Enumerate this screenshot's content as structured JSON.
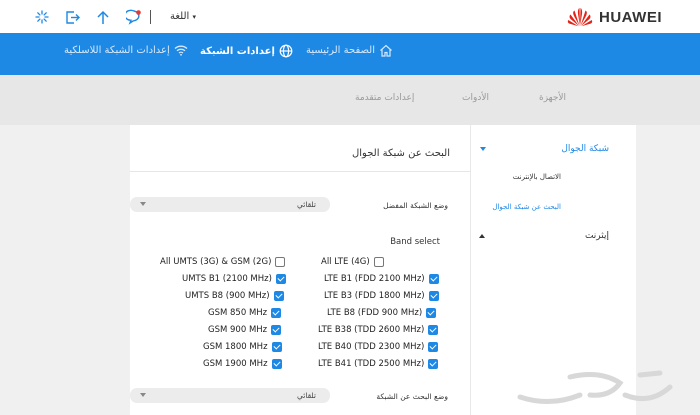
{
  "brand": {
    "name": "HUAWEI",
    "logo_color": "#e2231a"
  },
  "topbar": {
    "language_label": "اللغة",
    "icons": [
      "loading-icon",
      "logout-icon",
      "upload-icon",
      "message-icon"
    ]
  },
  "nav": {
    "items": [
      {
        "label": "الصفحة الرئيسية",
        "icon": "home-icon"
      },
      {
        "label": "إعدادات الشبكة",
        "icon": "globe-icon",
        "active": true
      },
      {
        "label": "إعدادات الشبكة اللاسلكية",
        "icon": "wifi-icon"
      }
    ],
    "color": "#1e88e5"
  },
  "subnav": {
    "items": [
      {
        "label": "الأجهزة"
      },
      {
        "label": "الأدوات"
      },
      {
        "label": "إعدادات متقدمة"
      }
    ]
  },
  "sidebar": {
    "sections": [
      {
        "label": "شبكة الجوال",
        "expanded": true,
        "items": [
          {
            "label": "الاتصال بالإنترنت"
          },
          {
            "label": "البحث عن شبكة الجوال",
            "active": true
          }
        ]
      },
      {
        "label": "إيثرنت",
        "expanded": false
      }
    ]
  },
  "content": {
    "title": "البحث عن شبكة الجوال",
    "preferred_mode": {
      "label": "وضع الشبكة المفضل",
      "value": "تلقائي"
    },
    "band_select_label": "Band select",
    "lte_bands": [
      {
        "label": "All LTE (4G)",
        "checked": false
      },
      {
        "label": "LTE B1 (FDD 2100 MHz)",
        "checked": true
      },
      {
        "label": "LTE B3 (FDD 1800 MHz)",
        "checked": true
      },
      {
        "label": "LTE B8 (FDD 900 MHz)",
        "checked": true
      },
      {
        "label": "LTE B38 (TDD 2600 MHz)",
        "checked": true
      },
      {
        "label": "LTE B40 (TDD 2300 MHz)",
        "checked": true
      },
      {
        "label": "LTE B41 (TDD 2500 MHz)",
        "checked": true
      }
    ],
    "umts_bands": [
      {
        "label": "All UMTS (3G) & GSM (2G)",
        "checked": false
      },
      {
        "label": "UMTS B1 (2100 MHz)",
        "checked": true
      },
      {
        "label": "UMTS B8 (900 MHz)",
        "checked": true
      },
      {
        "label": "GSM 850 MHz",
        "checked": true
      },
      {
        "label": "GSM 900 MHz",
        "checked": true
      },
      {
        "label": "GSM 1800 MHz",
        "checked": true
      },
      {
        "label": "GSM 1900 MHz",
        "checked": true
      }
    ],
    "search_mode": {
      "label": "وضع البحث عن الشبكة",
      "value": "تلقائي"
    }
  }
}
